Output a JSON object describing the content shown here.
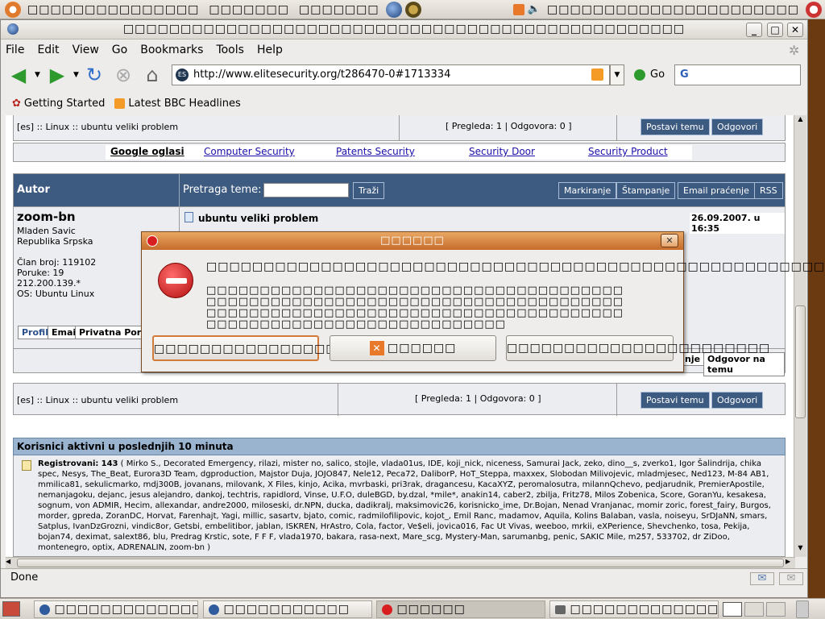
{
  "top_panel": {
    "menus": [
      "□□□□□□□□□□□□□□□",
      "□□□□□□□",
      "□□□□□□□"
    ],
    "right_text": "□□□□□□□□□□□□□□□□□□□□□□"
  },
  "window": {
    "title": "□□□□□□□□□□□□□□□□□□□□□□□□□□□□□□□□□□□□□□□□□□□□□□□□□",
    "controls": {
      "minimize": "_",
      "maximize": "□",
      "close": "✕"
    }
  },
  "menubar": [
    "File",
    "Edit",
    "View",
    "Go",
    "Bookmarks",
    "Tools",
    "Help"
  ],
  "navbar": {
    "url": "http://www.elitesecurity.org/t286470-0#1713334",
    "go_label": "Go",
    "search_value": "G"
  },
  "bookmarks": [
    "Getting Started",
    "Latest BBC Headlines"
  ],
  "page": {
    "breadcrumb": "[es] :: Linux :: ubuntu veliki problem",
    "stats": "[ Pregleda: 1 | Odgovora: 0 ]",
    "post_topic": "Postavi temu",
    "reply": "Odgovori",
    "google_ads": {
      "label": "Google oglasi",
      "links": [
        "Computer Security",
        "Patents Security",
        "Security Door",
        "Security Product"
      ]
    },
    "author_header": "Autor",
    "search_label": "Pretraga teme:",
    "search_button": "Traži",
    "tool_buttons": [
      "Markiranje",
      "Štampanje",
      "Email praćenje",
      "RSS"
    ],
    "post": {
      "author": "zoom-bn",
      "info_lines": [
        "Mladen Savic",
        "Republika Srpska",
        "",
        "Član broj: 119102",
        "Poruke: 19",
        "212.200.139.*",
        "OS: Ubuntu Linux"
      ],
      "title": "ubuntu veliki problem",
      "date": "26.09.2007. u 16:35",
      "profile_buttons": [
        "Profil",
        "Email",
        "Privatna Poruk"
      ],
      "bottom_buttons": [
        "nje",
        "Odgovor na temu"
      ]
    },
    "active_header": "Korisnici aktivni u poslednjih 10 minuta",
    "registered_label": "Registrovani:",
    "registered_count": "143",
    "users_text": "( Mirko S., Decorated Emergency, rilazi, mister no, salico, stojle, vlada01us, IDE, koji_nick, niceness, Samurai Jack, zeko, dino__s, zverko1, Igor Šalindrija, chika spec, Nesys, The_Beat, Eurora3D Team, dgproduction, Majstor Duja, JOJO847, Nele12, Peca72, DaliborP, HoT_Steppa, maxxex, Slobodan Milivojevic, mladmjesec, Ned123, M-84 AB1, mmilica81, sekulicmarko, mdj300B, jovanans, milovank, X Files, kinjo, Acika, mvrbaski, pri3rak, dragancesu, KacaXYZ, peromalosutra, milannQchevo, pedjarudnik, PremierApostile, nemanjagoku, dejanc, jesus alejandro, dankoj, techtris, rapidlord, Vinse, U.F.O, duleBGD, by.dzal, *mile*, anakin14, caber2, zbilja, Fritz78, Milos Zobenica, Score, GoranYu, kesakesa, sognum, von ADMIR, Hecim, allexandar, andre2000, miloseski, dr.NPN, ducka, dadikralj, maksimovic26, korisnicko_ime, Dr.Bojan, Nenad Vranjanac, momir zoric, forest_fairy, Burgos, morder, gpreda, ZoranDC, Horvat, Farenhajt, Yagi, millic, sasartv, bjato, comic, radmilofilipovic, kojot_, Emil Ranc, madamov, Aquila, Kolins Balaban, vasla, noiseyu, SrDJaNN, smars, Satplus, IvanDzGrozni, vindic8or, Getsbi, embelitibor, jablan, ISKREN, HrAstro, Cola, factor, Ve$eli, jovica016, Fac Ut Vivas, weeboo, mrkii, eXPerience, Shevchenko, tosa, Pekija, bojan74, deximat, salext86, blu, Predrag Krstic, sote, F F F, vlada1970, bakara, rasa-next, Mare_scg, Mystery-Man, sarumanbg, penic, SAKIC Mile, m257, 533702, dr ZiDoo, montenegro, optix, ADRENALIN, zoom-bn )"
  },
  "dialog": {
    "title": "□□□□□□",
    "primary_text": "□□□□□□□□□□□□□□□□□□□□□□□□□□□□□□□□□□□□□□□□□□□□□□□□□□□□□□□",
    "secondary_text": "□□□□□□□□□□□□□□□□□□□□□□□□□□□□□□□□□□□□□□□□□□□□□□□□□□□□□□□□□□□□□□□□□□□□□□□□□□□□□□□□□□□□□□□□□□□□□□□□□□□□□□□□□□□□□□□□□□□□□□□□□□□□□□□□□□□□□□□□□□□□□□□□□",
    "button_left": "□□□□□□□□□□□□□□□□□□□□□□□□□□",
    "button_cancel": "□□□□□□",
    "button_right": "□□□□□□□□□□□□□□□□□□□□□□□"
  },
  "statusbar": {
    "text": "Done"
  },
  "taskbar": [
    "□□□□□□□□□□□□□□□□□□□□□□□",
    "□□□□□□□□□□□",
    "□□□□□□",
    "□□□□□□□□□□□□□□□□□□□□□□□□□□□"
  ],
  "colors": {
    "accent_blue": "#3d5a80",
    "dialog_title": "#d27a38",
    "link": "#1a0fa8",
    "error_red": "#d81e1e"
  }
}
